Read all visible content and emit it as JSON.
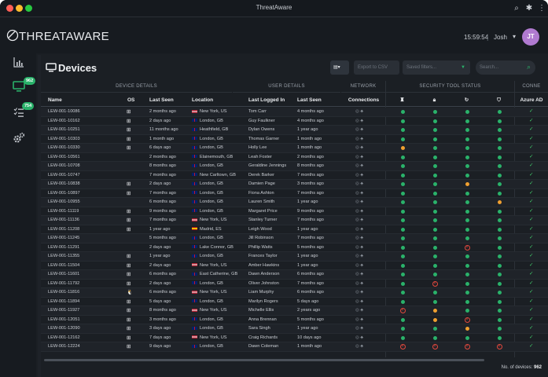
{
  "window": {
    "title": "ThreatAware"
  },
  "header": {
    "logo_text": "THREATAWARE",
    "time": "15:59:54",
    "separator": "|",
    "user": "Josh",
    "avatar": "JT"
  },
  "sidebar": {
    "items": [
      {
        "name": "dashboard",
        "icon": "bar-chart-icon"
      },
      {
        "name": "devices",
        "icon": "monitor-icon",
        "badge": "962"
      },
      {
        "name": "tasks",
        "icon": "list-check-icon",
        "badge": "754"
      },
      {
        "name": "settings",
        "icon": "gears-icon"
      }
    ]
  },
  "page": {
    "title": "Devices",
    "export_label": "Export to CSV",
    "saved_filters_placeholder": "Saved filters...",
    "search_placeholder": "Search..."
  },
  "groups": [
    "DEVICE DETAILS",
    "USER DETAILS",
    "NETWORK",
    "SECURITY TOOL STATUS",
    "CONNE"
  ],
  "columns": [
    "Name",
    "OS",
    "Last Seen",
    "Location",
    "Last Logged In",
    "Last Seen",
    "Connections",
    "",
    "",
    "",
    "",
    "Azure AD"
  ],
  "rows": [
    [
      "LEW-001-10086",
      "win",
      "2 months ago",
      "us",
      "New York, US",
      "Tom Carr",
      "4 months ago",
      "g",
      "g",
      "g",
      "g",
      "c"
    ],
    [
      "LEW-001-10162",
      "win",
      "2 days ago",
      "gb",
      "London, GB",
      "Guy Faulkner",
      "4 months ago",
      "g",
      "g",
      "g",
      "g",
      "c"
    ],
    [
      "LEW-001-10251",
      "win",
      "11 months ago",
      "gb",
      "Heathfield, GB",
      "Dylan Owens",
      "1 year ago",
      "g",
      "g",
      "g",
      "g",
      "c"
    ],
    [
      "LEW-001-10303",
      "win",
      "1 month ago",
      "gb",
      "London, GB",
      "Thomas Garner",
      "1 month ago",
      "g",
      "g",
      "g",
      "g",
      "c"
    ],
    [
      "LEW-001-10330",
      "win",
      "6 days ago",
      "gb",
      "London, GB",
      "Holly Lee",
      "1 month ago",
      "o",
      "g",
      "g",
      "g",
      "c"
    ],
    [
      "LEW-001-10561",
      "mac",
      "2 months ago",
      "gb",
      "Elainemouth, GB",
      "Leah Foster",
      "2 months ago",
      "g",
      "g",
      "g",
      "g",
      "c"
    ],
    [
      "LEW-001-10708",
      "mac",
      "8 months ago",
      "gb",
      "London, GB",
      "Geraldine Jennings",
      "8 months ago",
      "g",
      "g",
      "g",
      "g",
      "c"
    ],
    [
      "LEW-001-10747",
      "mac",
      "7 months ago",
      "gb",
      "New Carltown, GB",
      "Derek Barker",
      "7 months ago",
      "g",
      "g",
      "g",
      "g",
      "c"
    ],
    [
      "LEW-001-10838",
      "win",
      "2 days ago",
      "gb",
      "London, GB",
      "Damien Page",
      "3 months ago",
      "g",
      "g",
      "o",
      "g",
      "c"
    ],
    [
      "LEW-001-10897",
      "win",
      "7 months ago",
      "gb",
      "London, GB",
      "Fiona Ashton",
      "7 months ago",
      "g",
      "g",
      "g",
      "g",
      "c"
    ],
    [
      "LEW-001-10955",
      "mac",
      "6 months ago",
      "gb",
      "London, GB",
      "Lauren Smith",
      "1 year ago",
      "g",
      "g",
      "g",
      "o",
      "c"
    ],
    [
      "LEW-001-11119",
      "win",
      "9 months ago",
      "gb",
      "London, GB",
      "Margaret Price",
      "9 months ago",
      "g",
      "g",
      "g",
      "g",
      "c"
    ],
    [
      "LEW-001-11136",
      "win",
      "7 months ago",
      "us",
      "New York, US",
      "Stanley Turner",
      "7 months ago",
      "g",
      "g",
      "g",
      "g",
      "c"
    ],
    [
      "LEW-001-11208",
      "win",
      "1 year ago",
      "es",
      "Madrid, ES",
      "Leigh Wood",
      "1 year ago",
      "g",
      "g",
      "g",
      "g",
      "c"
    ],
    [
      "LEW-001-11245",
      "mac",
      "5 months ago",
      "gb",
      "London, GB",
      "Jill Robinson",
      "7 months ago",
      "g",
      "g",
      "g",
      "g",
      "c"
    ],
    [
      "LEW-001-11291",
      "mac",
      "2 days ago",
      "gb",
      "Lake Connor, GB",
      "Phillip Watts",
      "5 months ago",
      "g",
      "g",
      "x",
      "g",
      "c"
    ],
    [
      "LEW-001-11355",
      "win",
      "1 year ago",
      "gb",
      "London, GB",
      "Frances Taylor",
      "1 year ago",
      "g",
      "g",
      "g",
      "g",
      "c"
    ],
    [
      "LEW-001-11504",
      "win",
      "2 days ago",
      "us",
      "New York, US",
      "Amber Hawkins",
      "1 year ago",
      "g",
      "g",
      "g",
      "g",
      "c"
    ],
    [
      "LEW-001-11601",
      "win",
      "6 months ago",
      "gb",
      "East Catherine, GB",
      "Dawn Anderson",
      "6 months ago",
      "g",
      "g",
      "g",
      "g",
      "c"
    ],
    [
      "LEW-001-11792",
      "win",
      "2 days ago",
      "gb",
      "London, GB",
      "Oliver Johnston",
      "7 months ago",
      "g",
      "x",
      "g",
      "g",
      "c"
    ],
    [
      "LEW-001-11816",
      "lin",
      "6 months ago",
      "us",
      "New York, US",
      "Liam Murphy",
      "6 months ago",
      "g",
      "g",
      "g",
      "g",
      "c"
    ],
    [
      "LEW-001-11894",
      "win",
      "5 days ago",
      "gb",
      "London, GB",
      "Marilyn Rogers",
      "5 days ago",
      "g",
      "g",
      "g",
      "g",
      "c"
    ],
    [
      "LEW-001-11927",
      "win",
      "8 months ago",
      "us",
      "New York, US",
      "Michelle Ellis",
      "2 years ago",
      "x",
      "o",
      "g",
      "g",
      "c"
    ],
    [
      "LEW-001-12051",
      "win",
      "3 months ago",
      "gb",
      "London, GB",
      "Anna Brennan",
      "5 months ago",
      "g",
      "o",
      "x",
      "g",
      "c"
    ],
    [
      "LEW-001-12090",
      "win",
      "3 days ago",
      "gb",
      "London, GB",
      "Sara Singh",
      "1 year ago",
      "g",
      "g",
      "o",
      "g",
      "c"
    ],
    [
      "LEW-001-12162",
      "win",
      "7 days ago",
      "us",
      "New York, US",
      "Craig Richards",
      "10 days ago",
      "g",
      "g",
      "g",
      "g",
      "c"
    ],
    [
      "LEW-001-12224",
      "win",
      "9 days ago",
      "gb",
      "London, GB",
      "Dawn Coleman",
      "1 month ago",
      "x",
      "x",
      "x",
      "x",
      "c"
    ]
  ],
  "footer": {
    "count_label": "No. of devices:",
    "count": "962"
  },
  "colors": {
    "green": "#2ab26a",
    "orange": "#f0a030",
    "red": "#e2483d",
    "accent": "#b07ad0"
  }
}
